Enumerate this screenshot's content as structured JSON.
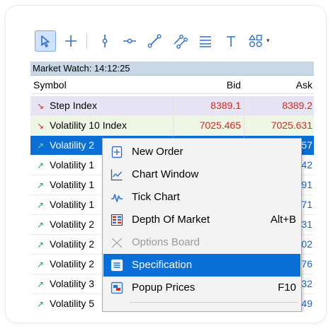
{
  "market_watch": {
    "title": "Market Watch: 14:12:25",
    "columns": {
      "symbol": "Symbol",
      "bid": "Bid",
      "ask": "Ask"
    },
    "rows": [
      {
        "symbol": "Step Index",
        "bid": "8389.1",
        "ask": "8389.2",
        "direction": "down"
      },
      {
        "symbol": "Volatility 10 Index",
        "bid": "7025.465",
        "ask": "7025.631",
        "direction": "down"
      },
      {
        "symbol": "Volatility 2",
        "bid": "",
        "ask": "57",
        "direction": "up"
      },
      {
        "symbol": "Volatility 1",
        "bid": "",
        "ask": "42",
        "direction": "up"
      },
      {
        "symbol": "Volatility 1",
        "bid": "",
        "ask": "91",
        "direction": "up"
      },
      {
        "symbol": "Volatility 1",
        "bid": "",
        "ask": "71",
        "direction": "up"
      },
      {
        "symbol": "Volatility 2",
        "bid": "",
        "ask": "31",
        "direction": "up"
      },
      {
        "symbol": "Volatility 2",
        "bid": "",
        "ask": "02",
        "direction": "up"
      },
      {
        "symbol": "Volatility 2",
        "bid": "",
        "ask": "76",
        "direction": "up"
      },
      {
        "symbol": "Volatility 3",
        "bid": "",
        "ask": "32",
        "direction": "up"
      },
      {
        "symbol": "Volatility 5",
        "bid": "",
        "ask": "49",
        "direction": "up"
      }
    ]
  },
  "context_menu": {
    "items": [
      {
        "label": "New Order",
        "shortcut": "",
        "icon": "new-order-icon"
      },
      {
        "label": "Chart Window",
        "shortcut": "",
        "icon": "chart-window-icon"
      },
      {
        "label": "Tick Chart",
        "shortcut": "",
        "icon": "tick-chart-icon"
      },
      {
        "label": "Depth Of Market",
        "shortcut": "Alt+B",
        "icon": "depth-of-market-icon"
      },
      {
        "label": "Options Board",
        "shortcut": "",
        "icon": "options-board-icon"
      },
      {
        "label": "Specification",
        "shortcut": "",
        "icon": "specification-icon"
      },
      {
        "label": "Popup Prices",
        "shortcut": "F10",
        "icon": "popup-prices-icon"
      }
    ]
  },
  "toolbar": {
    "icons": [
      "cursor-icon",
      "crosshair-icon",
      "vertical-line-icon",
      "horizontal-line-icon",
      "trend-line-icon",
      "channel-icon",
      "fibonacci-icon",
      "text-icon",
      "shapes-icon"
    ]
  },
  "colors": {
    "selection": "#0a6fd6",
    "down": "#e0261f",
    "up": "#1aa84a",
    "row_step": "#e6e4f5",
    "row_vol10": "#eef7e6",
    "toolbar_icon": "#2f6fd0"
  }
}
